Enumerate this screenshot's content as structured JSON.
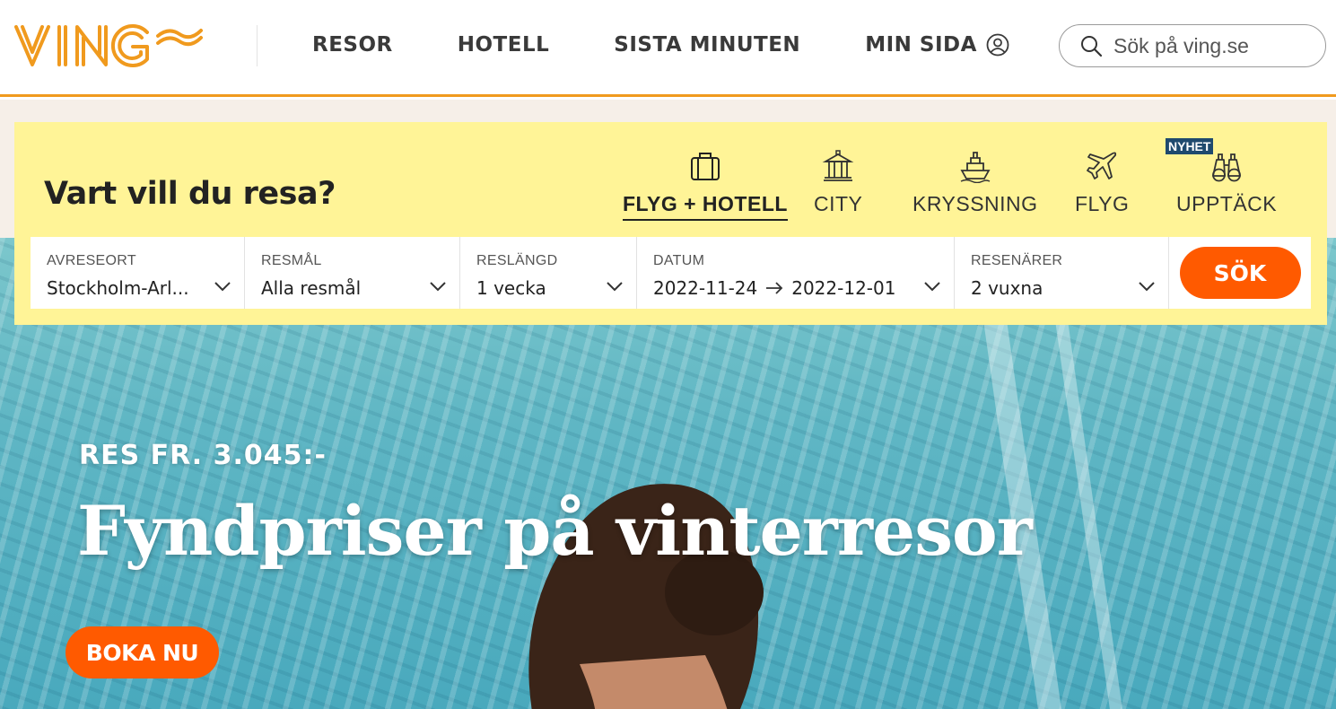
{
  "header": {
    "logo_text": "VING",
    "nav": [
      {
        "label": "RESOR"
      },
      {
        "label": "HOTELL"
      },
      {
        "label": "SISTA MINUTEN"
      },
      {
        "label": "MIN SIDA",
        "icon": "user-icon"
      }
    ],
    "search": {
      "placeholder": "Sök på ving.se",
      "icon": "search-icon"
    }
  },
  "search_panel": {
    "title": "Vart vill du resa?",
    "tabs": [
      {
        "label": "FLYG + HOTELL",
        "icon": "suitcase-icon",
        "active": true
      },
      {
        "label": "CITY",
        "icon": "building-icon",
        "active": false
      },
      {
        "label": "KRYSSNING",
        "icon": "ship-icon",
        "active": false
      },
      {
        "label": "FLYG",
        "icon": "airplane-icon",
        "active": false
      },
      {
        "label": "UPPTÄCK",
        "icon": "binoculars-icon",
        "active": false,
        "badge": "NYHET"
      }
    ],
    "fields": [
      {
        "label": "AVRESEORT",
        "value": "Stockholm-Arl..."
      },
      {
        "label": "RESMÅL",
        "value": "Alla resmål"
      },
      {
        "label": "RESLÄNGD",
        "value": "1 vecka"
      },
      {
        "label": "DATUM",
        "value_from": "2022-11-24",
        "value_to": "2022-12-01"
      },
      {
        "label": "RESENÄRER",
        "value": "2 vuxna"
      }
    ],
    "search_button": "SÖK"
  },
  "hero": {
    "subtitle": "RES FR. 3.045:-",
    "title": "Fyndpriser på vinterresor",
    "cta": "BOKA NU"
  },
  "colors": {
    "brand_orange": "#f09a1e",
    "cta_orange": "#ff5a00",
    "panel_yellow": "#fff497",
    "badge_blue": "#1f4a6e"
  }
}
